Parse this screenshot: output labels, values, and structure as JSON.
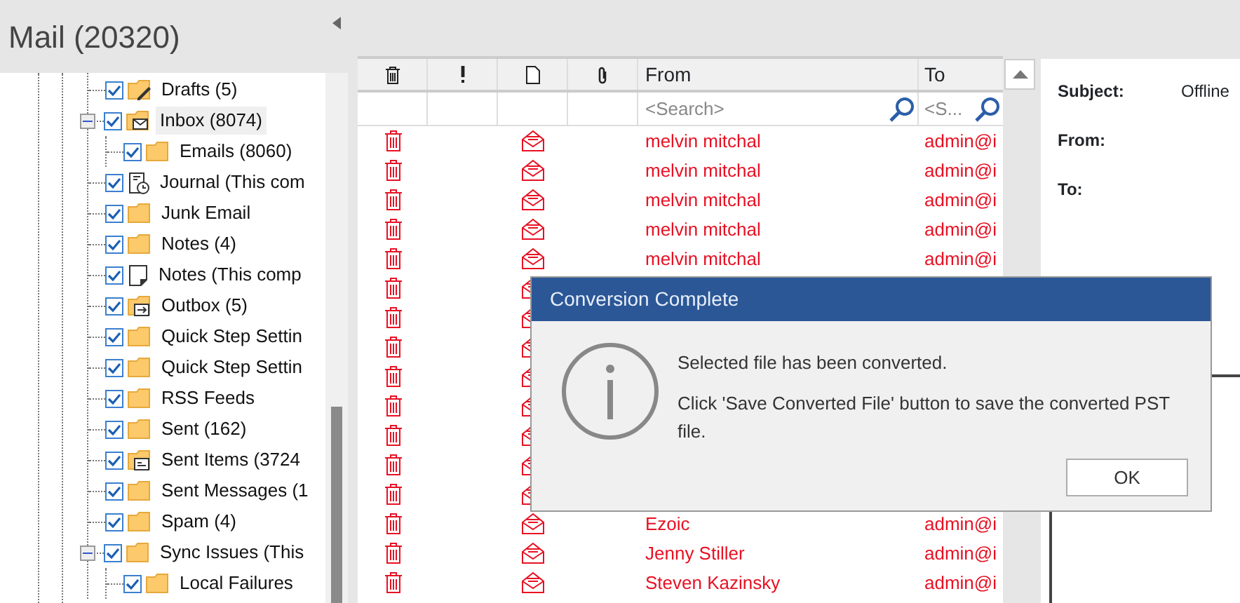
{
  "sidebar": {
    "title": "Mail (20320)",
    "tree": [
      {
        "label": "Drafts (5)",
        "kind": "drafts",
        "checked": true,
        "selected": false
      },
      {
        "label": "Inbox (8074)",
        "kind": "inbox",
        "checked": true,
        "selected": true,
        "expanded": true,
        "children": [
          {
            "label": "Emails (8060)",
            "kind": "folder",
            "checked": true,
            "selected": false
          }
        ]
      },
      {
        "label": "Journal (This com",
        "kind": "journal",
        "checked": true,
        "selected": false
      },
      {
        "label": "Junk Email",
        "kind": "folder",
        "checked": true,
        "selected": false
      },
      {
        "label": "Notes (4)",
        "kind": "folder",
        "checked": true,
        "selected": false
      },
      {
        "label": "Notes (This comp",
        "kind": "note",
        "checked": true,
        "selected": false
      },
      {
        "label": "Outbox (5)",
        "kind": "outbox",
        "checked": true,
        "selected": false
      },
      {
        "label": "Quick Step Settin",
        "kind": "folder",
        "checked": true,
        "selected": false
      },
      {
        "label": "Quick Step Settin",
        "kind": "folder",
        "checked": true,
        "selected": false
      },
      {
        "label": "RSS Feeds",
        "kind": "folder",
        "checked": true,
        "selected": false
      },
      {
        "label": "Sent (162)",
        "kind": "folder",
        "checked": true,
        "selected": false
      },
      {
        "label": "Sent Items (3724",
        "kind": "sent",
        "checked": true,
        "selected": false
      },
      {
        "label": "Sent Messages (1",
        "kind": "folder",
        "checked": true,
        "selected": false
      },
      {
        "label": "Spam (4)",
        "kind": "folder",
        "checked": true,
        "selected": false
      },
      {
        "label": "Sync Issues (This",
        "kind": "folder",
        "checked": true,
        "selected": false,
        "expanded": true,
        "children": [
          {
            "label": "Local Failures",
            "kind": "folder",
            "checked": true,
            "selected": false
          }
        ]
      }
    ]
  },
  "message_list": {
    "columns": [
      "From",
      "To"
    ],
    "search": [
      {
        "placeholder": "<Search>"
      },
      {
        "placeholder": "<S..."
      }
    ],
    "rows": [
      {
        "kind": "mail",
        "from": "melvin mitchal",
        "to": "admin@i"
      },
      {
        "kind": "mail",
        "from": "melvin mitchal",
        "to": "admin@i"
      },
      {
        "kind": "mail",
        "from": "melvin mitchal",
        "to": "admin@i"
      },
      {
        "kind": "mail",
        "from": "melvin mitchal",
        "to": "admin@i"
      },
      {
        "kind": "mail",
        "from": "melvin mitchal",
        "to": "admin@i"
      },
      {
        "kind": "mail"
      },
      {
        "kind": "mail"
      },
      {
        "kind": "mail"
      },
      {
        "kind": "mail"
      },
      {
        "kind": "mail"
      },
      {
        "kind": "mail"
      },
      {
        "kind": "mail"
      },
      {
        "kind": "mail"
      },
      {
        "kind": "mail",
        "from": "Ezoic",
        "to": "admin@i"
      },
      {
        "kind": "mail",
        "from": "Jenny Stiller",
        "to": "admin@i"
      },
      {
        "kind": "mail",
        "from": "Steven Kazinsky",
        "to": "admin@i"
      }
    ]
  },
  "preview": {
    "fields": [
      {
        "label": "Subject:",
        "value": "Offline"
      },
      {
        "label": "From:"
      },
      {
        "label": "To:"
      }
    ]
  },
  "dialog": {
    "title": "Conversion Complete",
    "message": "Selected file has been converted.",
    "detail": "Click 'Save Converted File' button to save the converted PST file.",
    "button": "OK"
  }
}
